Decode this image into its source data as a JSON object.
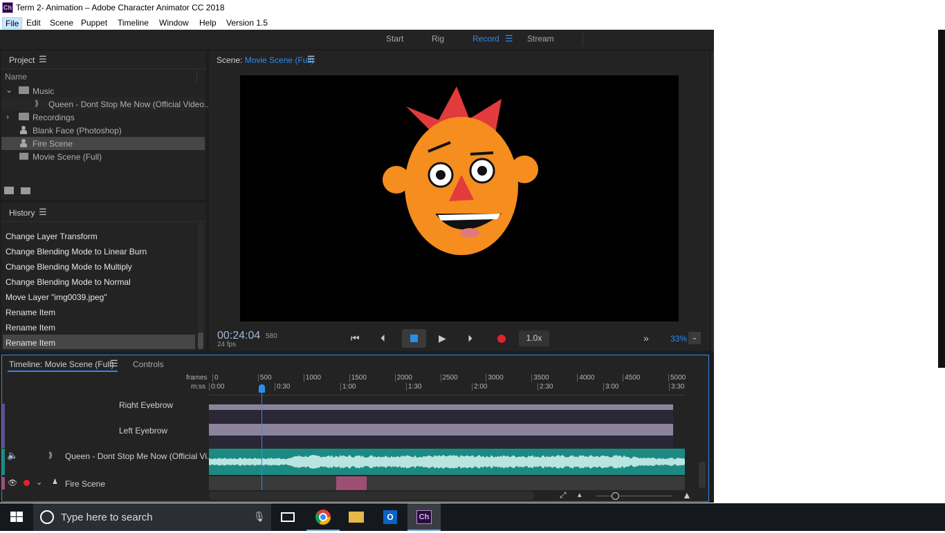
{
  "window": {
    "title": "Term 2- Animation – Adobe Character Animator CC 2018",
    "app_icon": "Ch"
  },
  "menu": [
    "File",
    "Edit",
    "Scene",
    "Puppet",
    "Timeline",
    "Window",
    "Help",
    "Version 1.5"
  ],
  "workspaces": {
    "start": "Start",
    "rig": "Rig",
    "record": "Record",
    "stream": "Stream"
  },
  "project": {
    "title": "Project",
    "col_name": "Name",
    "items": [
      {
        "label": "Music"
      },
      {
        "label": "Queen - Dont Stop Me Now (Official Video..."
      },
      {
        "label": "Recordings"
      },
      {
        "label": "Blank Face (Photoshop)"
      },
      {
        "label": "Fire Scene"
      },
      {
        "label": "Movie Scene (Full)"
      }
    ]
  },
  "history": {
    "title": "History",
    "items": [
      "Change Layer Transform",
      "Change Blending Mode to Linear Burn",
      "Change Blending Mode to Multiply",
      "Change Blending Mode to Normal",
      "Move Layer \"img0039.jpeg\"",
      "Rename Item",
      "Rename Item",
      "Rename Item"
    ]
  },
  "scene": {
    "prefix": "Scene:",
    "name": "Movie Scene (Full)"
  },
  "transport": {
    "timecode": "00:24:04",
    "frame": "580",
    "fps": "24 fps",
    "speed": "1.0x",
    "zoom": "33%"
  },
  "timeline": {
    "tab": "Timeline: Movie Scene (Full)",
    "controls_tab": "Controls",
    "frames_label": "frames",
    "mss_label": "m:ss",
    "frame_ticks": [
      "0",
      "500",
      "1000",
      "1500",
      "2000",
      "2500",
      "3000",
      "3500",
      "4000",
      "4500",
      "5000"
    ],
    "time_ticks": [
      "0:00",
      "0:30",
      "1:00",
      "1:30",
      "2:00",
      "2:30",
      "3:00",
      "3:30"
    ],
    "tracks": {
      "right_eyebrow": "Right Eyebrow",
      "left_eyebrow": "Left Eyebrow",
      "audio": "Queen - Dont Stop Me Now (Official Vi...",
      "fire_scene": "Fire Scene"
    }
  },
  "taskbar": {
    "search_placeholder": "Type here to search"
  },
  "colors": {
    "accent": "#2d8ceb",
    "record_red": "#e0232c",
    "audio_teal": "#1c8a82",
    "puppet_track": "#8c849c",
    "fire_clip": "#9c4f72",
    "face_orange": "#f58d1f",
    "hair_red": "#e23b3b"
  }
}
